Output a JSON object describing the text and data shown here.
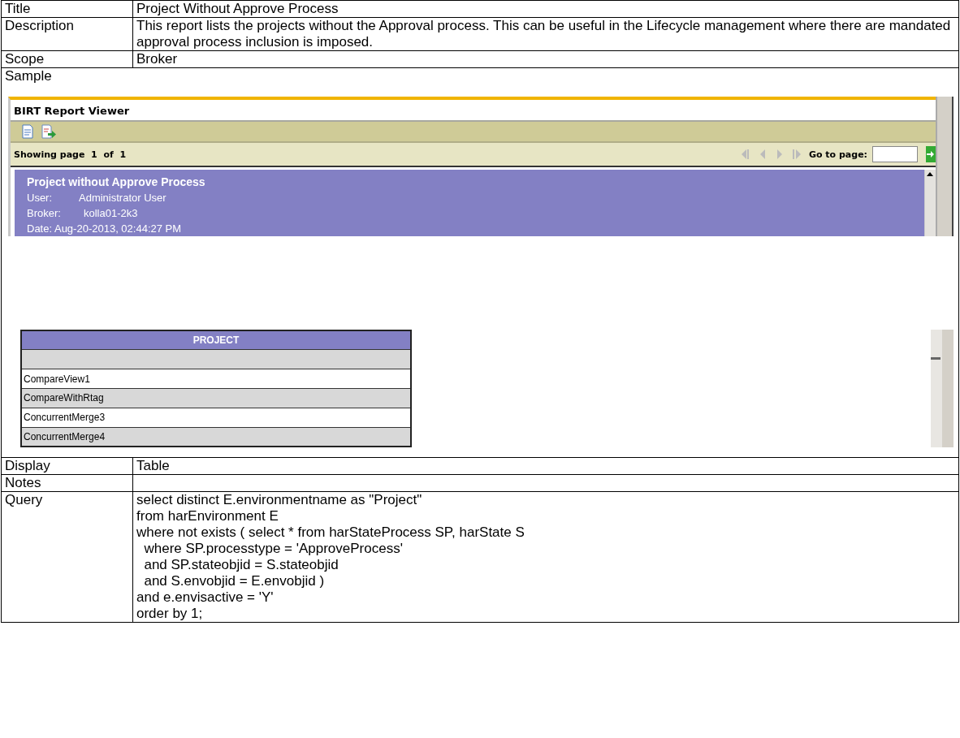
{
  "rows": [
    {
      "kind": "text",
      "label": "Title",
      "value": "Project Without Approve Process"
    },
    {
      "kind": "text",
      "label": "Description",
      "value": "This report lists the projects without the Approval process. This can be useful in the Lifecycle management where there are mandated approval process inclusion is imposed."
    },
    {
      "kind": "text",
      "label": "Scope",
      "value": "Broker"
    },
    {
      "kind": "sample",
      "label": "Sample",
      "viewer": {
        "title": "BIRT Report Viewer",
        "status": "Showing page  1  of  1",
        "goto_label": "Go to page:",
        "report": {
          "title": "Project without Approve Process",
          "user_label": "User:",
          "user": "Administrator User",
          "broker_label": "Broker:",
          "broker": "kolla01-2k3",
          "date": "Date: Aug-20-2013, 02:44:27 PM"
        },
        "table": {
          "column": "PROJECT",
          "rows": [
            "CompareView1",
            "CompareWithRtag",
            "ConcurrentMerge3",
            "ConcurrentMerge4"
          ]
        }
      }
    },
    {
      "kind": "text",
      "label": "Display",
      "value": "Table"
    },
    {
      "kind": "text",
      "label": "Notes"
    },
    {
      "kind": "query",
      "label": "Query",
      "lines": [
        "select distinct E.environmentname as \"Project\"",
        "from harEnvironment E",
        "where not exists ( select * from harStateProcess SP, harState S",
        "  where SP.processtype = 'ApproveProcess'",
        "  and SP.stateobjid = S.stateobjid",
        "  and S.envobjid = E.envobjid )",
        "and e.envisactive = 'Y'",
        "order by 1;"
      ]
    }
  ]
}
